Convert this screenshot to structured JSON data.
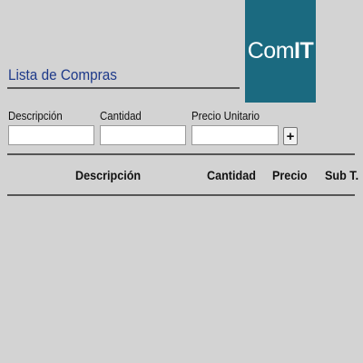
{
  "logo": {
    "text_light": "Com",
    "text_bold": "IT",
    "background": "#1b6a80"
  },
  "header": {
    "title": "Lista de Compras"
  },
  "form": {
    "description_label": "Descripción",
    "description_value": "",
    "quantity_label": "Cantidad",
    "quantity_value": "",
    "unit_price_label": "Precio Unitario",
    "unit_price_value": "",
    "add_button_label": "+"
  },
  "table": {
    "columns": [
      "Descripción",
      "Cantidad",
      "Precio",
      "Sub T."
    ],
    "rows": []
  },
  "colors": {
    "background": "#d3d3d3",
    "title": "#1e3a8a",
    "rule": "#555555"
  }
}
